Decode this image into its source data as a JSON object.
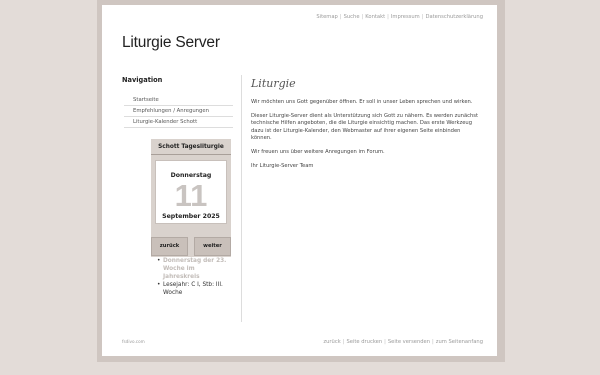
{
  "topnav": [
    "Sitemap",
    "Suche",
    "Kontakt",
    "Impressum",
    "Datenschutzerklärung"
  ],
  "site_title": "Liturgie Server",
  "navigation": {
    "heading": "Navigation",
    "items": [
      "Startseite",
      "Empfehlungen / Anregungen",
      "Liturgie-Kalender Schott"
    ]
  },
  "content": {
    "title": "Liturgie",
    "paragraphs": [
      "Wir möchten uns Gott gegenüber öffnen. Er soll in unser Leben sprechen und wirken.",
      "Dieser Liturgie-Server dient als Unterstützung sich Gott zu nähern. Es werden zunächst technische Hilfen angeboten, die die Liturgie einsichtig machen. Das erste Werkzeug dazu ist der Liturgie-Kalender, den Webmaster auf ihrer eigenen Seite einbinden können.",
      "Wir freuen uns über weitere Anregungen im Forum.",
      "Ihr Liturgie-Server Team"
    ]
  },
  "widget": {
    "title": "Schott Tagesliturgie",
    "weekday": "Donnerstag",
    "day": "11",
    "month_year": "September 2025",
    "prev_label": "zurück",
    "next_label": "weiter",
    "liturgy_day": "Donnerstag der 23. Woche im Jahreskreis",
    "reading_year": "Lesejahr: C I, Stb: III. Woche"
  },
  "footer": {
    "left": "fsdivo.com",
    "links": [
      "zurück",
      "Seite drucken",
      "Seite versenden",
      "zum Seitenanfang"
    ]
  }
}
